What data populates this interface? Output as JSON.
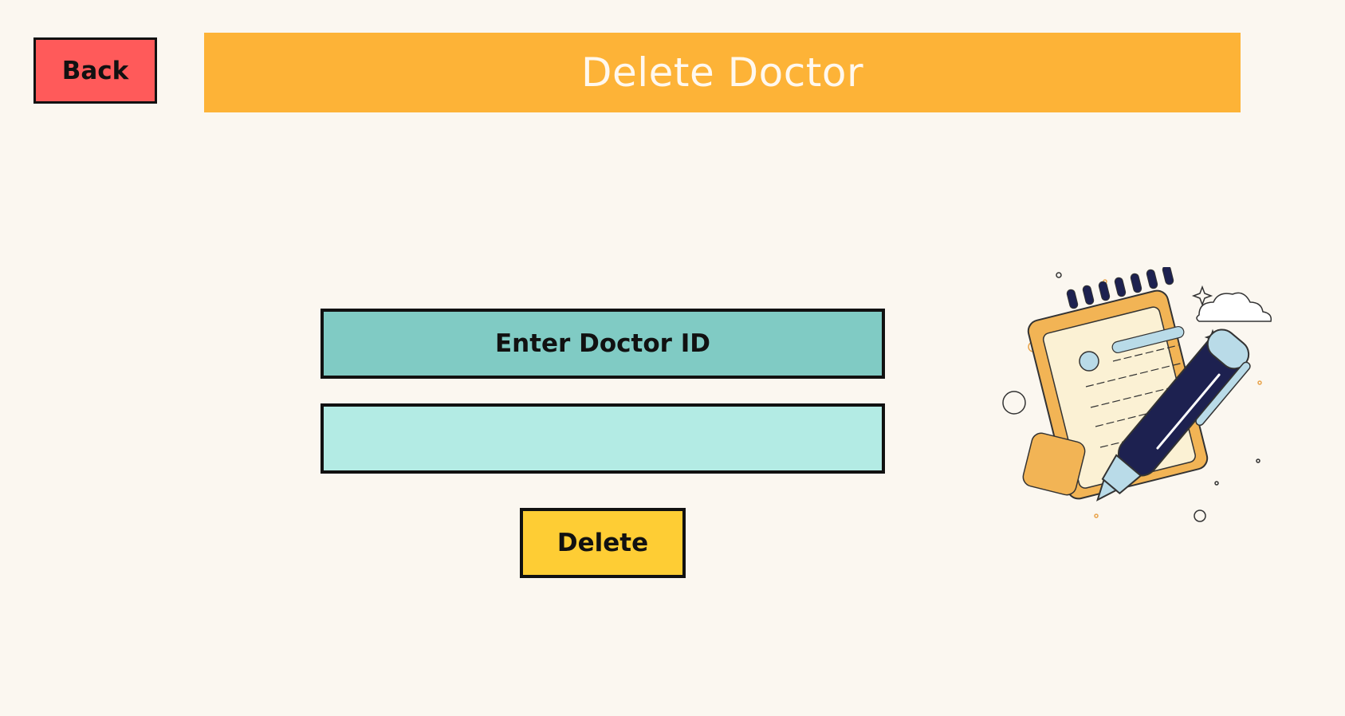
{
  "header": {
    "back_label": "Back",
    "title": "Delete Doctor"
  },
  "form": {
    "id_label": "Enter Doctor ID",
    "id_value": "",
    "id_placeholder": "",
    "delete_label": "Delete"
  },
  "colors": {
    "background": "#fbf7f0",
    "back_button": "#ff5a5a",
    "title_bar": "#fdb337",
    "label_bg": "#80cbc4",
    "input_bg": "#b3ebe4",
    "delete_button": "#fecd34"
  },
  "icons": {
    "illustration": "notepad-and-pen-illustration"
  }
}
